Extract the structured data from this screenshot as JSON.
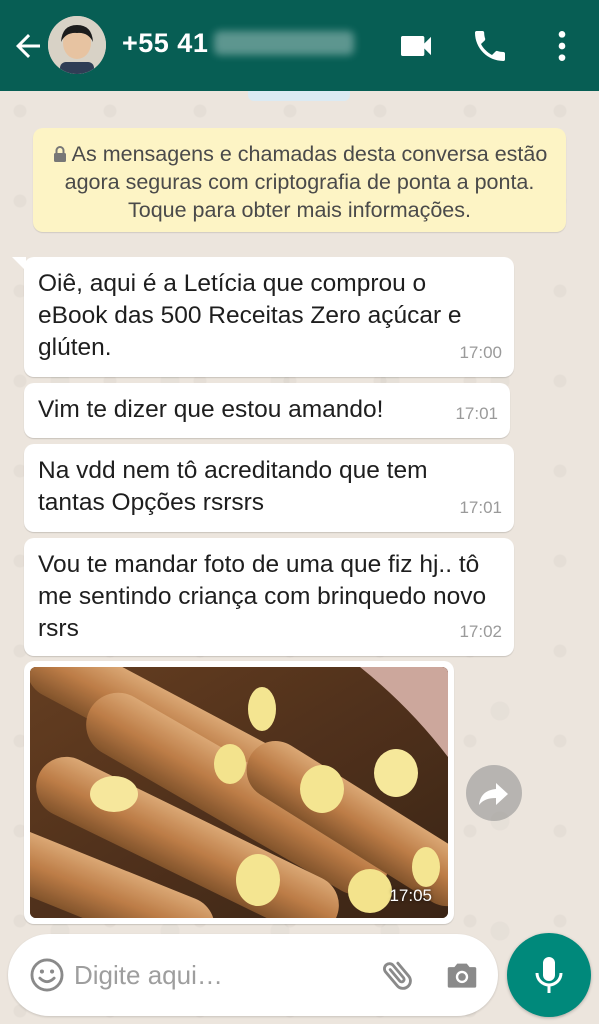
{
  "header": {
    "contact_name": "+55 41",
    "back_icon": "arrow-left-icon",
    "video_icon": "video-camera-icon",
    "call_icon": "phone-icon",
    "menu_icon": "more-vertical-icon",
    "bg_color": "#075e54"
  },
  "system_message": {
    "text": "As mensagens e chamadas desta conversa estão agora seguras com criptografia de ponta a ponta. Toque para obter mais informações.",
    "icon": "lock-icon"
  },
  "messages": [
    {
      "text": "Oiê, aqui é a Letícia que comprou o eBook das 500 Receitas Zero açúcar e glúten.",
      "time": "17:00"
    },
    {
      "text": "Vim te dizer que estou amando!",
      "time": "17:01"
    },
    {
      "text": "Na vdd nem tô acreditando que tem tantas Opções rsrsrs",
      "time": "17:01"
    },
    {
      "text": "Vou te mandar foto de uma que fiz hj.. tô me sentindo criança com brinquedo novo rsrs",
      "time": "17:02"
    }
  ],
  "photo_message": {
    "time": "17:05",
    "forward_icon": "forward-arrow-icon"
  },
  "composer": {
    "placeholder": "Digite aqui…",
    "emoji_icon": "emoji-icon",
    "attach_icon": "paperclip-icon",
    "camera_icon": "camera-icon",
    "mic_icon": "microphone-icon",
    "accent_color": "#00897b"
  }
}
